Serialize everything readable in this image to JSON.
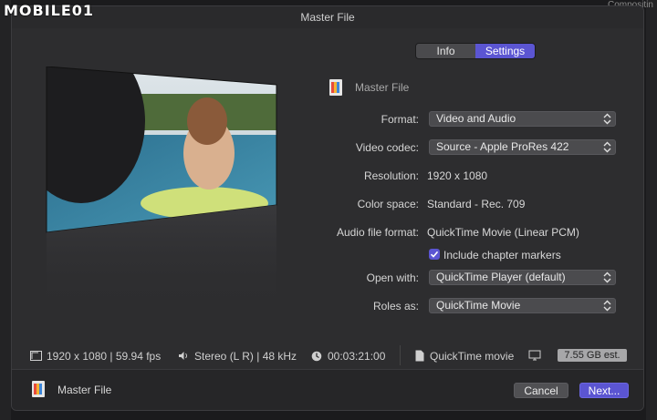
{
  "watermark": "MOBILE01",
  "background_hint": "Compositin",
  "window": {
    "title": "Master File"
  },
  "tabs": [
    {
      "label": "Info",
      "selected": false
    },
    {
      "label": "Settings",
      "selected": true
    }
  ],
  "preset": {
    "name": "Master File"
  },
  "settings": {
    "format": {
      "label": "Format:",
      "value": "Video and Audio"
    },
    "video_codec": {
      "label": "Video codec:",
      "value": "Source - Apple ProRes 422"
    },
    "resolution": {
      "label": "Resolution:",
      "value": "1920 x 1080"
    },
    "color_space": {
      "label": "Color space:",
      "value": "Standard - Rec. 709"
    },
    "audio_format": {
      "label": "Audio file format:",
      "value": "QuickTime Movie (Linear PCM)"
    },
    "chapter_markers": {
      "label": "Include chapter markers",
      "checked": true
    },
    "open_with": {
      "label": "Open with:",
      "value": "QuickTime Player (default)"
    },
    "roles_as": {
      "label": "Roles as:",
      "value": "QuickTime Movie"
    }
  },
  "summary": {
    "video": "1920 x 1080 | 59.94 fps",
    "audio": "Stereo (L R) | 48 kHz",
    "duration": "00:03:21:00",
    "file_type": "QuickTime movie",
    "size_estimate": "7.55 GB est."
  },
  "footer": {
    "title": "Master File",
    "cancel_label": "Cancel",
    "next_label": "Next..."
  },
  "colors": {
    "accent": "#5b55d2",
    "dialog_bg": "#2d2d2f",
    "popup_bg": "#4b4b4e"
  },
  "icons": [
    "master-file-icon",
    "display-icon",
    "speaker-icon",
    "clock-icon",
    "document-icon",
    "monitor-icon",
    "popup-arrows-icon",
    "checkmark-icon"
  ]
}
